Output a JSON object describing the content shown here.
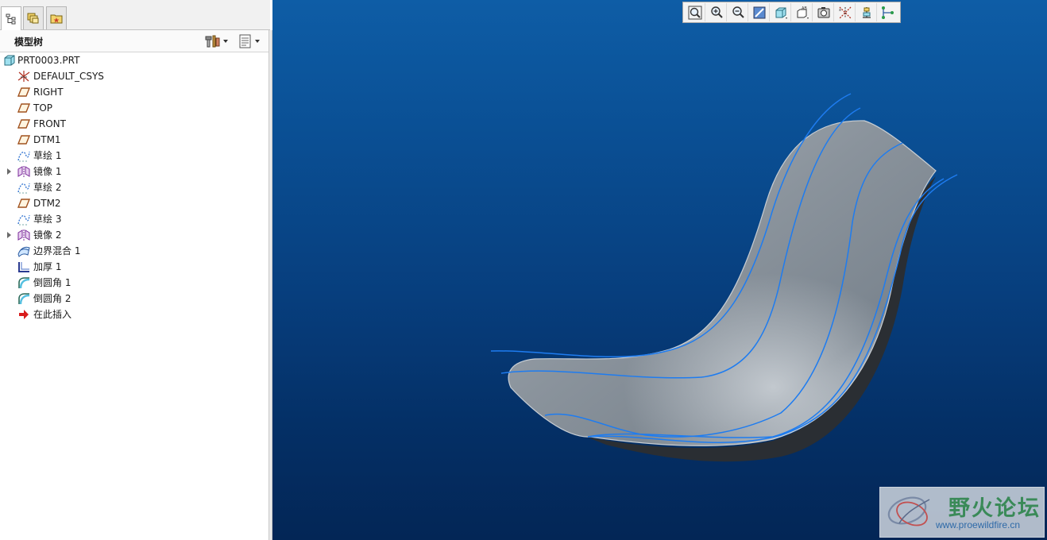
{
  "left_panel": {
    "tabs": [
      {
        "icon": "model-tree-icon"
      },
      {
        "icon": "layers-icon"
      },
      {
        "icon": "favorites-folder-icon"
      }
    ],
    "tree_title": "模型树",
    "settings_icon": "tree-settings-icon",
    "show_icon": "tree-show-icon",
    "tree": [
      {
        "label": "PRT0003.PRT",
        "icon": "part-icon",
        "expandable": false
      },
      {
        "label": "DEFAULT_CSYS",
        "icon": "csys-icon",
        "expandable": false
      },
      {
        "label": "RIGHT",
        "icon": "datum-plane-icon",
        "expandable": false
      },
      {
        "label": "TOP",
        "icon": "datum-plane-icon",
        "expandable": false
      },
      {
        "label": "FRONT",
        "icon": "datum-plane-icon",
        "expandable": false
      },
      {
        "label": "DTM1",
        "icon": "datum-plane-icon",
        "expandable": false
      },
      {
        "label": "草绘 1",
        "icon": "sketch-icon",
        "expandable": false
      },
      {
        "label": "镜像 1",
        "icon": "mirror-icon",
        "expandable": true
      },
      {
        "label": "草绘 2",
        "icon": "sketch-icon",
        "expandable": false
      },
      {
        "label": "DTM2",
        "icon": "datum-plane-icon",
        "expandable": false
      },
      {
        "label": "草绘 3",
        "icon": "sketch-icon",
        "expandable": false
      },
      {
        "label": "镜像 2",
        "icon": "mirror-icon",
        "expandable": true
      },
      {
        "label": "边界混合 1",
        "icon": "boundary-blend-icon",
        "expandable": false
      },
      {
        "label": "加厚 1",
        "icon": "thicken-icon",
        "expandable": false
      },
      {
        "label": "倒圆角 1",
        "icon": "round-icon",
        "expandable": false
      },
      {
        "label": "倒圆角 2",
        "icon": "round-icon",
        "expandable": false
      },
      {
        "label": "在此插入",
        "icon": "insert-here-arrow-icon",
        "expandable": false
      }
    ]
  },
  "view_toolbar": [
    {
      "icon": "refit-icon"
    },
    {
      "icon": "zoom-in-icon"
    },
    {
      "icon": "zoom-out-icon"
    },
    {
      "icon": "repaint-icon"
    },
    {
      "icon": "display-style-icon"
    },
    {
      "icon": "saved-views-icon"
    },
    {
      "icon": "view-manager-icon"
    },
    {
      "icon": "datum-display-icon"
    },
    {
      "icon": "spin-center-icon"
    },
    {
      "icon": "annotation-display-icon"
    }
  ],
  "watermark": {
    "title": "野火论坛",
    "url": "www.proewildfire.cn"
  },
  "colors": {
    "viewport_top": "#0e5da6",
    "viewport_bottom": "#032656",
    "model_surface": "#8c96a0",
    "curve": "#1e7cf0"
  }
}
